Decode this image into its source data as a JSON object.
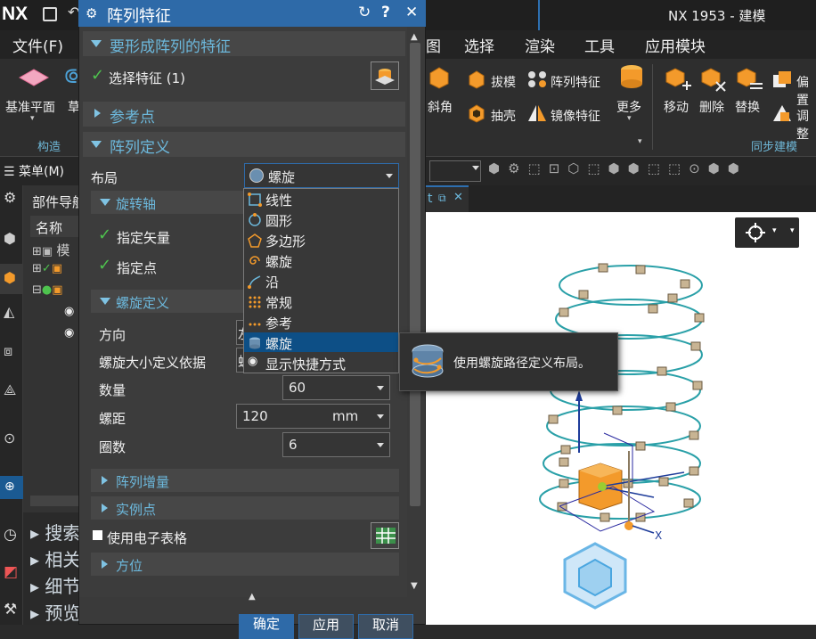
{
  "app": {
    "logo": "NX",
    "title": "NX 1953 - 建模"
  },
  "menubar": {
    "file": "文件(F)",
    "items": [
      "图",
      "选择",
      "渲染",
      "工具",
      "应用模块"
    ]
  },
  "ribbon": {
    "datum_plane": "基准平面",
    "grass_partial": "草",
    "group_construct": "构造",
    "chamfer": "斜角",
    "draft": "拔模",
    "shell": "抽壳",
    "pattern_feature": "阵列特征",
    "mirror_feature": "镜像特征",
    "more": "更多",
    "move": "移动",
    "delete": "删除",
    "replace": "替换",
    "offset": "偏置",
    "adjust": "调整",
    "group_sync": "同步建模"
  },
  "toolbar2": {
    "menu_label": "菜单(M)"
  },
  "tabs": {
    "view_tab_partial": "t"
  },
  "navigator": {
    "title": "部件导航",
    "col_name": "名称",
    "row1": "模",
    "sections": [
      "搜索",
      "相关",
      "细节",
      "预览"
    ]
  },
  "dialog": {
    "title": "阵列特征",
    "sec_features": "要形成阵列的特征",
    "select_feature": "选择特征 (1)",
    "sec_ref_point": "参考点",
    "sec_pattern_def": "阵列定义",
    "layout_label": "布局",
    "layout_value": "螺旋",
    "sub_rotation_axis": "旋转轴",
    "specify_vector": "指定矢量",
    "specify_point": "指定点",
    "sub_helix_def": "螺旋定义",
    "direction_label": "方向",
    "direction_partial": "左",
    "size_by_label": "螺旋大小定义依据",
    "size_by_partial": "螺",
    "count_label": "数量",
    "count_value": "60",
    "pitch_label": "螺距",
    "pitch_value": "120",
    "pitch_unit": "mm",
    "turns_label": "圈数",
    "turns_value": "6",
    "sub_increment": "阵列增量",
    "sub_instance_points": "实例点",
    "use_spreadsheet": "使用电子表格",
    "sub_orientation": "方位",
    "btn_ok": "确定",
    "btn_apply": "应用",
    "btn_cancel": "取消"
  },
  "dropdown": {
    "items": [
      "线性",
      "圆形",
      "多边形",
      "螺旋",
      "沿",
      "常规",
      "参考",
      "螺旋",
      "显示快捷方式"
    ],
    "highlighted_index": 7
  },
  "tooltip": {
    "text": "使用螺旋路径定义布局。"
  },
  "viewport": {
    "axis_x": "X"
  }
}
